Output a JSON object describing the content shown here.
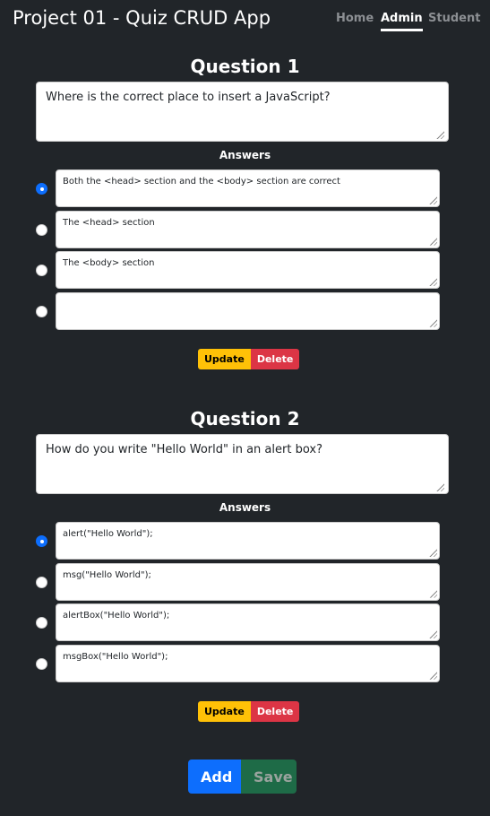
{
  "app": {
    "title": "Project 01 - Quiz CRUD App"
  },
  "nav": [
    {
      "label": "Home"
    },
    {
      "label": "Admin",
      "active": true
    },
    {
      "label": "Student"
    }
  ],
  "answers_label": "Answers",
  "update_label": "Update",
  "delete_label": "Delete",
  "add_label": "Add",
  "save_label": "Save",
  "questions": [
    {
      "title": "Question 1",
      "text": "Where is the correct place to insert a JavaScript?",
      "selected": 0,
      "answers": [
        "Both the <head> section and the <body> section are correct",
        "The <head> section",
        "The <body> section",
        ""
      ]
    },
    {
      "title": "Question 2",
      "text": "How do you write \"Hello World\" in an alert box?",
      "selected": 0,
      "answers": [
        "alert(\"Hello World\");",
        "msg(\"Hello World\");",
        "alertBox(\"Hello World\");",
        "msgBox(\"Hello World\");"
      ]
    }
  ]
}
